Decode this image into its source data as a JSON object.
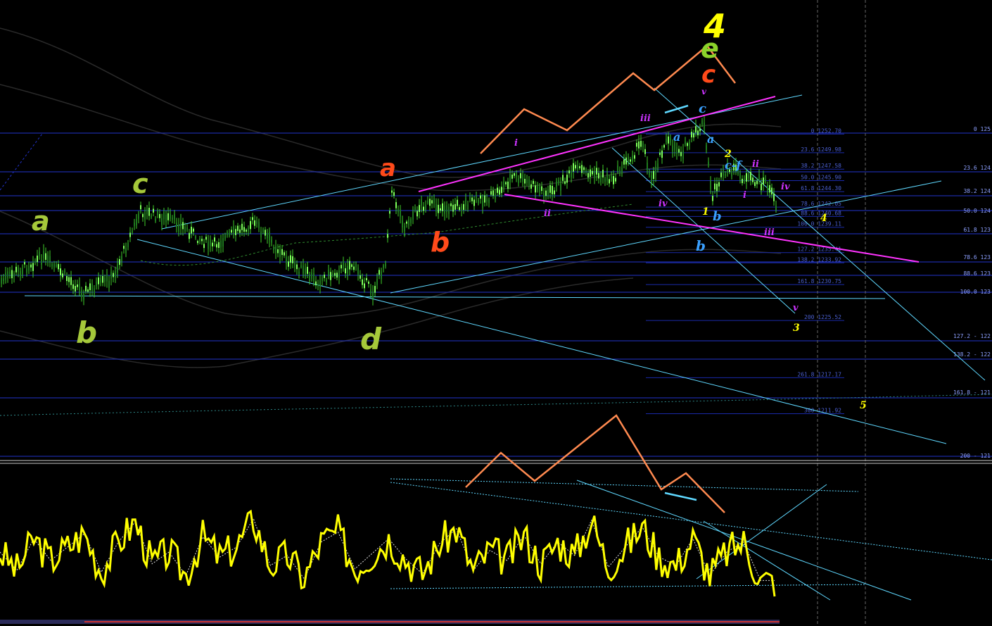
{
  "chart_data": [
    {
      "type": "line",
      "title": "",
      "xlabel": "",
      "ylabel": "",
      "ylim": [
        1210,
        1256
      ],
      "grid": false,
      "colors": {
        "background": "#000000",
        "candles": "#52ff3a",
        "horizontal_levels": "#2233cc",
        "channel": "#66d9ff",
        "magenta": "#ff33ff",
        "orange": "#ff8040"
      },
      "fib_levels": [
        {
          "label": "0 1252.70",
          "price": 1252.7
        },
        {
          "label": "23.6 1249.98",
          "price": 1249.98
        },
        {
          "label": "38.2 1247.58",
          "price": 1247.58
        },
        {
          "label": "50.0 1245.90",
          "price": 1245.9
        },
        {
          "label": "61.8 1244.30",
          "price": 1244.3
        },
        {
          "label": "78.6 1242.05",
          "price": 1242.05
        },
        {
          "label": "88.6 1240.68",
          "price": 1240.68
        },
        {
          "label": "100.0 1239.11",
          "price": 1239.11
        },
        {
          "label": "127.2 1235.41",
          "price": 1235.41
        },
        {
          "label": "138.2 1233.92",
          "price": 1233.92
        },
        {
          "label": "161.8 1230.75",
          "price": 1230.75
        },
        {
          "label": "200 1225.52",
          "price": 1225.52
        },
        {
          "label": "261.8 1217.17",
          "price": 1217.17
        },
        {
          "label": "300 1211.92",
          "price": 1211.92
        }
      ],
      "right_fib_labels": [
        "0 125",
        "23.6 124",
        "38.2 124",
        "50.0 124",
        "61.8 123",
        "78.6 123",
        "88.6 123",
        "100.0 123",
        "127.2 - 122",
        "138.2 - 122",
        "161.8 - 121",
        "200 - 121"
      ],
      "wave_labels": {
        "top_count": "4",
        "top_e": "e",
        "top_c": "c",
        "green_a1": "a",
        "green_b1": "b",
        "green_c1": "c",
        "green_d": "d",
        "red_a": "a",
        "red_b": "b",
        "blue_c": "c",
        "blue_a1": "a",
        "blue_a2": "a",
        "blue_b1": "b",
        "blue_b2": "b",
        "blue_cf": "c-f",
        "mag_v1": "v",
        "mag_i1": "i",
        "mag_ii1": "ii",
        "mag_iii1": "iii",
        "mag_iv1": "iv",
        "mag_i2": "i",
        "mag_ii2": "ii",
        "mag_iii2": "iii",
        "mag_iv2": "iv",
        "mag_v2": "v",
        "yellow_1": "1",
        "yellow_2": "2",
        "yellow_3": "3",
        "yellow_4": "4",
        "yellow_5": "5"
      }
    },
    {
      "type": "line",
      "title": "",
      "series": [
        {
          "values": [
            52,
            41,
            60,
            47,
            55,
            63,
            40,
            58,
            70,
            45,
            52,
            38,
            61,
            49,
            55,
            72,
            44,
            50,
            36,
            58,
            64,
            42,
            51,
            60,
            48,
            39,
            57,
            66,
            41,
            53,
            47,
            62,
            45,
            58,
            50,
            71,
            43,
            55,
            67,
            49,
            44,
            60,
            38,
            52,
            58,
            35
          ]
        }
      ],
      "ylim": [
        20,
        100
      ],
      "colors": {
        "oscillator": "#ffff00",
        "signal": "#dddddd"
      }
    }
  ]
}
